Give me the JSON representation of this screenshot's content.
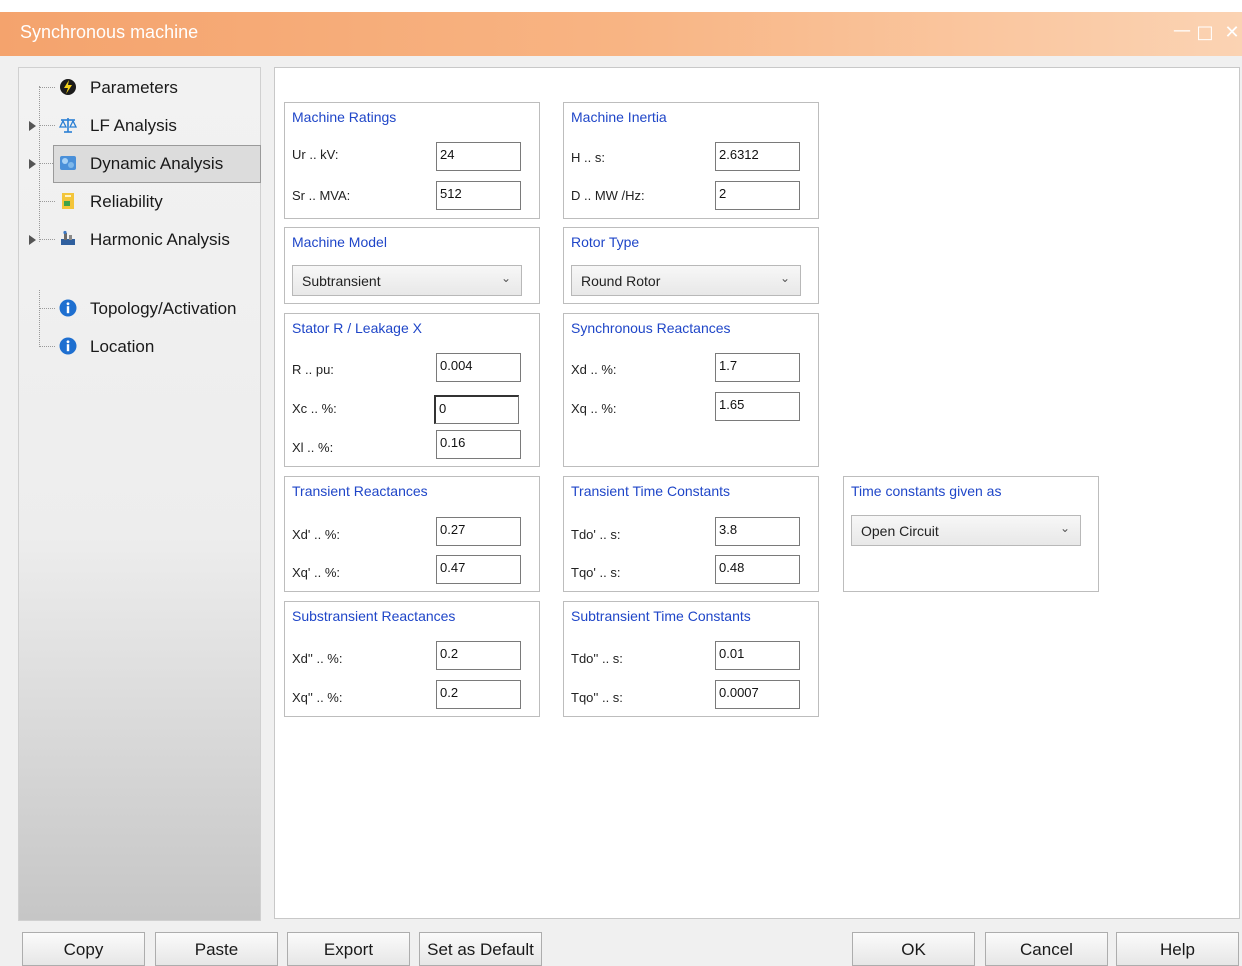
{
  "window": {
    "title": "Synchronous machine"
  },
  "nav": {
    "items": [
      {
        "label": "Parameters",
        "icon": "lightning-icon"
      },
      {
        "label": "LF Analysis",
        "icon": "scales-icon"
      },
      {
        "label": "Dynamic Analysis",
        "icon": "dynamic-analysis-icon",
        "selected": true
      },
      {
        "label": "Reliability",
        "icon": "reliability-icon"
      },
      {
        "label": "Harmonic Analysis",
        "icon": "harmonic-analysis-icon"
      },
      {
        "label": "Topology/Activation",
        "icon": "info-icon"
      },
      {
        "label": "Location",
        "icon": "info-icon"
      }
    ]
  },
  "groups": {
    "machine_ratings": {
      "title": "Machine Ratings",
      "fields": [
        {
          "label": "Ur .. kV:",
          "value": "24"
        },
        {
          "label": "Sr .. MVA:",
          "value": "512"
        }
      ]
    },
    "machine_inertia": {
      "title": "Machine Inertia",
      "fields": [
        {
          "label": "H .. s:",
          "value": "2.6312"
        },
        {
          "label": "D .. MW /Hz:",
          "value": "2"
        }
      ]
    },
    "machine_model": {
      "title": "Machine Model",
      "selected": "Subtransient"
    },
    "rotor_type": {
      "title": "Rotor Type",
      "selected": "Round Rotor"
    },
    "stator": {
      "title": "Stator R / Leakage X",
      "fields": [
        {
          "label": "R .. pu:",
          "value": "0.004"
        },
        {
          "label": "Xc .. %:",
          "value": "0"
        },
        {
          "label": "Xl .. %:",
          "value": "0.16"
        }
      ]
    },
    "sync_reactances": {
      "title": "Synchronous Reactances",
      "fields": [
        {
          "label": "Xd .. %:",
          "value": "1.7"
        },
        {
          "label": "Xq .. %:",
          "value": "1.65"
        }
      ]
    },
    "transient_reactances": {
      "title": "Transient Reactances",
      "fields": [
        {
          "label": "Xd' .. %:",
          "value": "0.27"
        },
        {
          "label": "Xq' .. %:",
          "value": "0.47"
        }
      ]
    },
    "transient_time": {
      "title": "Transient Time Constants",
      "fields": [
        {
          "label": "Tdo' .. s:",
          "value": "3.8"
        },
        {
          "label": "Tqo' .. s:",
          "value": "0.48"
        }
      ]
    },
    "time_given_as": {
      "title": "Time constants given as",
      "selected": "Open Circuit"
    },
    "subtransient_reactances": {
      "title": "Substransient Reactances",
      "fields": [
        {
          "label": "Xd'' .. %:",
          "value": "0.2"
        },
        {
          "label": "Xq'' .. %:",
          "value": "0.2"
        }
      ]
    },
    "subtransient_time": {
      "title": "Subtransient Time Constants",
      "fields": [
        {
          "label": "Tdo'' .. s:",
          "value": "0.01"
        },
        {
          "label": "Tqo'' .. s:",
          "value": "0.0007"
        }
      ]
    }
  },
  "buttons": {
    "copy": "Copy",
    "paste": "Paste",
    "export": "Export",
    "set_default": "Set as Default",
    "ok": "OK",
    "cancel": "Cancel",
    "help": "Help"
  },
  "colors": {
    "title_bar": "#f4a36d",
    "group_title": "#1f46c8",
    "info_icon": "#1e6fd0"
  }
}
